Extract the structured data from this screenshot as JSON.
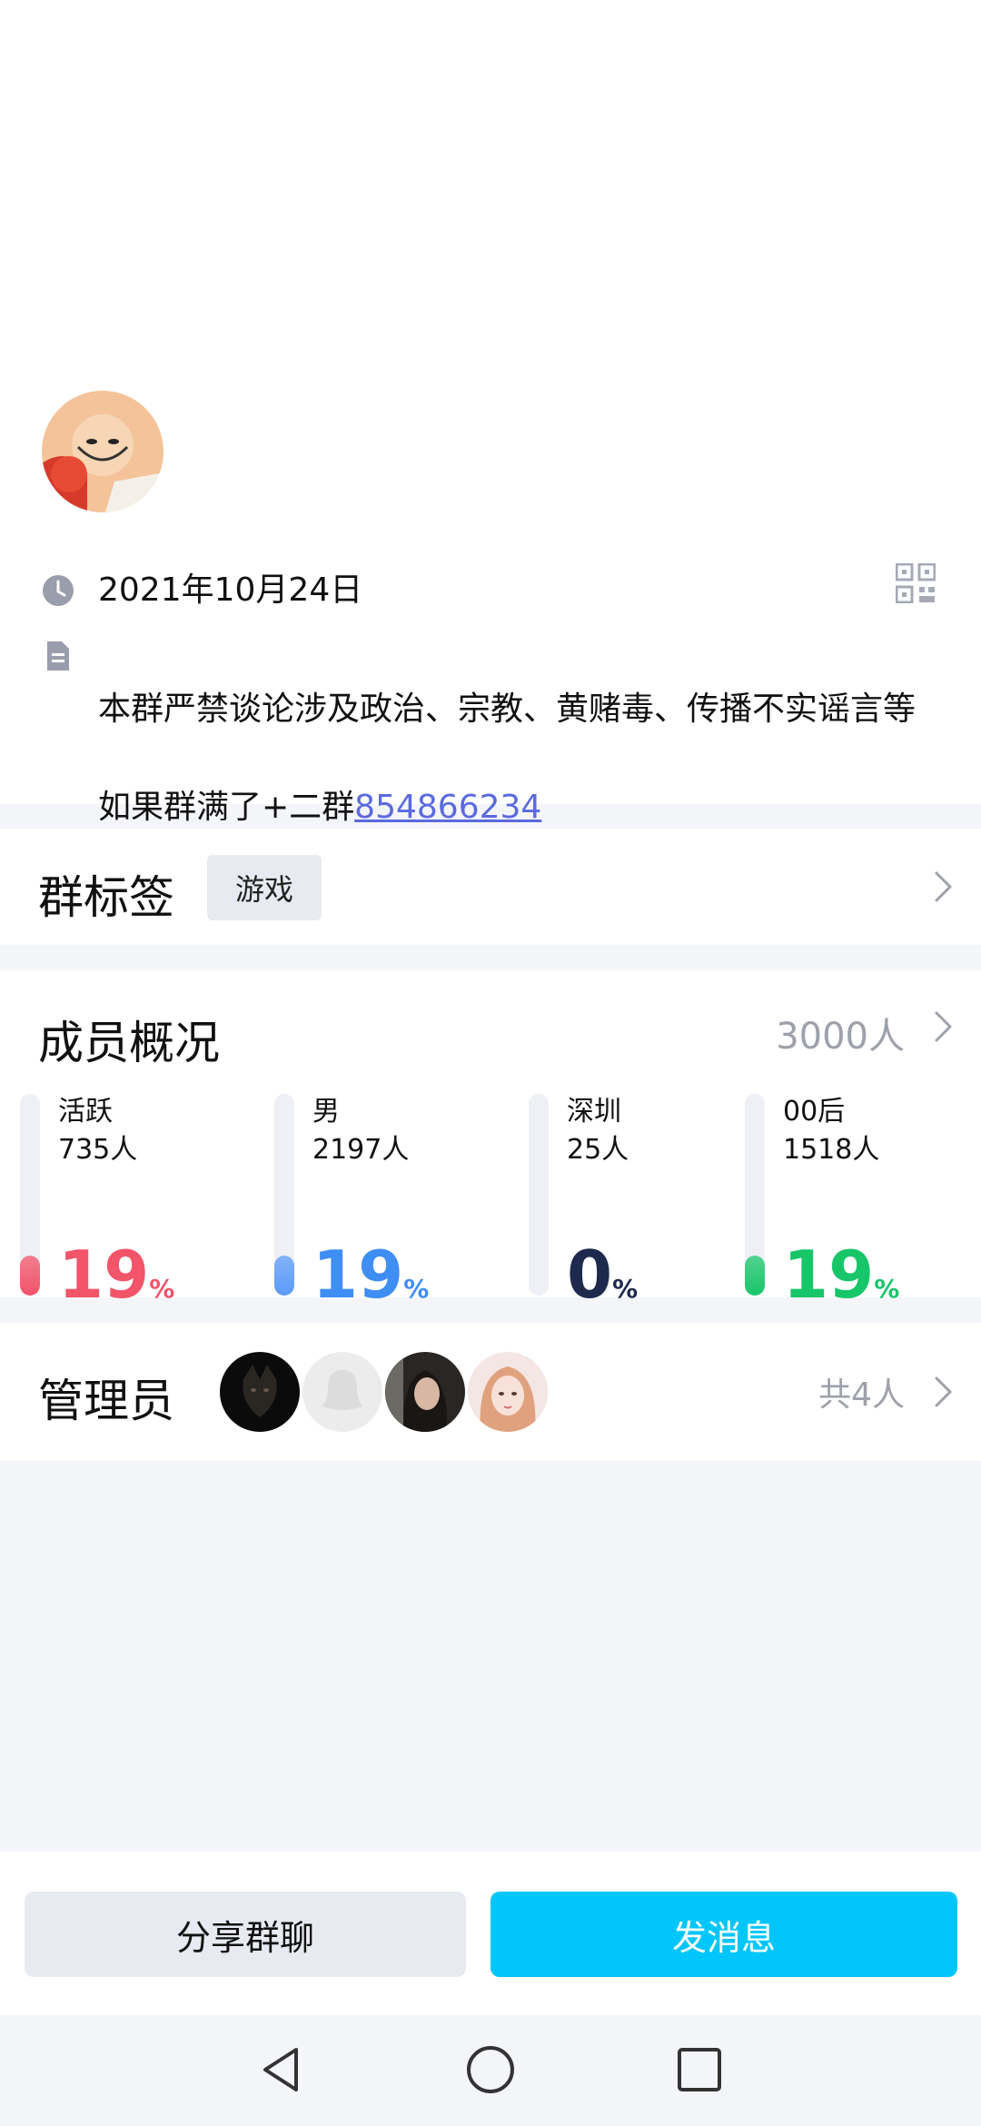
{
  "group": {
    "created_date": "2021年10月24日",
    "description_line1": "本群严禁谈论涉及政治、宗教、黄赌毒、传播不实谣言等",
    "description_line2_prefix": "如果群满了+二群",
    "description_link": "854866234"
  },
  "tags": {
    "title": "群标签",
    "items": [
      "游戏"
    ]
  },
  "members": {
    "title": "成员概况",
    "count": "3000人",
    "stats": [
      {
        "label": "活跃",
        "value": "735人",
        "percent": "19",
        "unit": "%",
        "fill_fraction": 0.19,
        "color": "#f2546a",
        "bar_color": "#f2546a"
      },
      {
        "label": "男",
        "value": "2197人",
        "percent": "19",
        "unit": "%",
        "fill_fraction": 0.19,
        "color": "#3f8ef4",
        "bar_color": "#5b9bf8"
      },
      {
        "label": "深圳",
        "value": "25人",
        "percent": "0",
        "unit": "%",
        "fill_fraction": 0.0,
        "color": "#1d2a4d",
        "bar_color": "#1d2a4d"
      },
      {
        "label": "00后",
        "value": "1518人",
        "percent": "19",
        "unit": "%",
        "fill_fraction": 0.19,
        "color": "#18c66a",
        "bar_color": "#18c66a"
      }
    ]
  },
  "admins": {
    "title": "管理员",
    "count": "共4人"
  },
  "actions": {
    "share_label": "分享群聊",
    "send_label": "发消息"
  },
  "colors": {
    "accent": "#00c6fc",
    "link": "#5b6ae0",
    "muted": "#9ea1ab"
  }
}
